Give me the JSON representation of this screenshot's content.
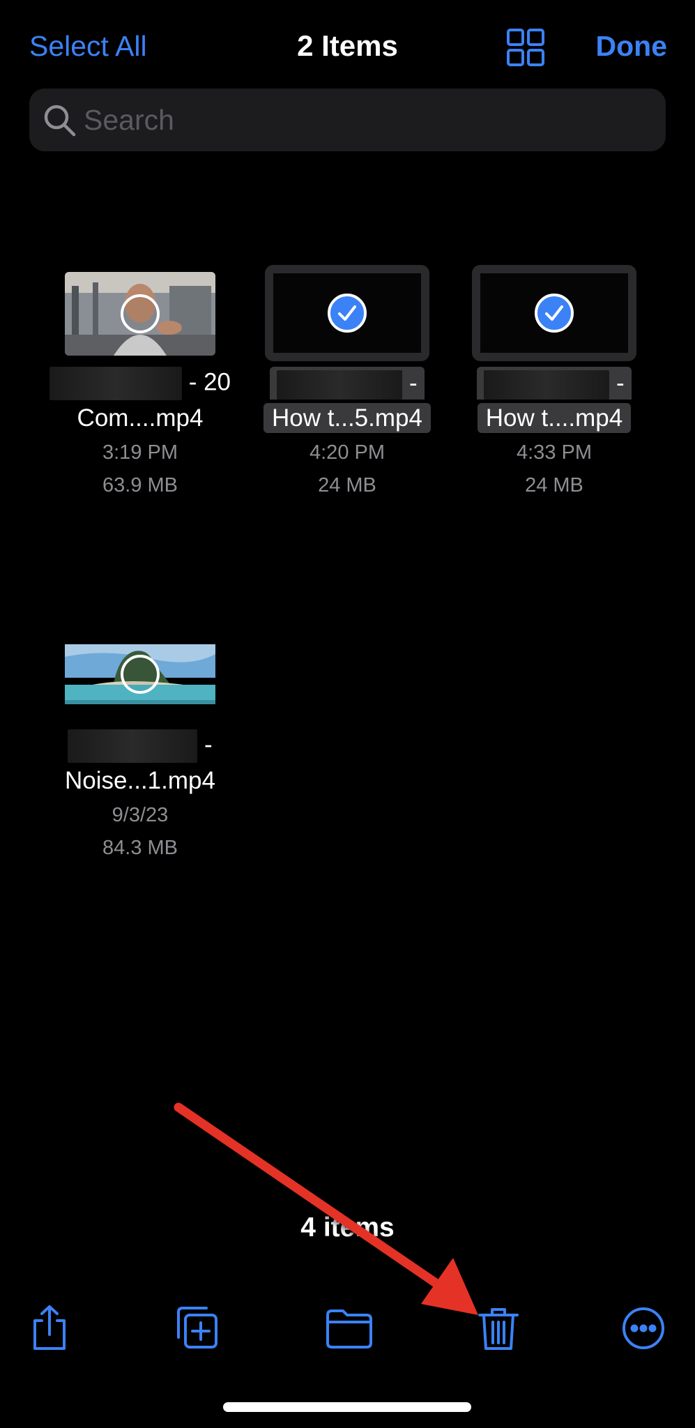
{
  "nav": {
    "select_all": "Select All",
    "title": "2 Items",
    "done": "Done"
  },
  "search": {
    "placeholder": "Search"
  },
  "files": [
    {
      "name_line1_suffix": "- 20",
      "name_line2": "Com....mp4",
      "time": "3:19 PM",
      "size": "63.9 MB",
      "selected": false
    },
    {
      "name_line1_suffix": "-",
      "name_line2": "How t...5.mp4",
      "time": "4:20 PM",
      "size": "24 MB",
      "selected": true
    },
    {
      "name_line1_suffix": "-",
      "name_line2": "How t....mp4",
      "time": "4:33 PM",
      "size": "24 MB",
      "selected": true
    },
    {
      "name_line1_suffix": "-",
      "name_line2": "Noise...1.mp4",
      "time": "9/3/23",
      "size": "84.3 MB",
      "selected": false
    }
  ],
  "footer": {
    "count": "4 items"
  },
  "toolbar": {
    "icons": [
      "share-icon",
      "duplicate-icon",
      "folder-icon",
      "trash-icon",
      "more-icon"
    ]
  },
  "colors": {
    "accent": "#3b82f6",
    "annotation_arrow": "#e53126"
  }
}
